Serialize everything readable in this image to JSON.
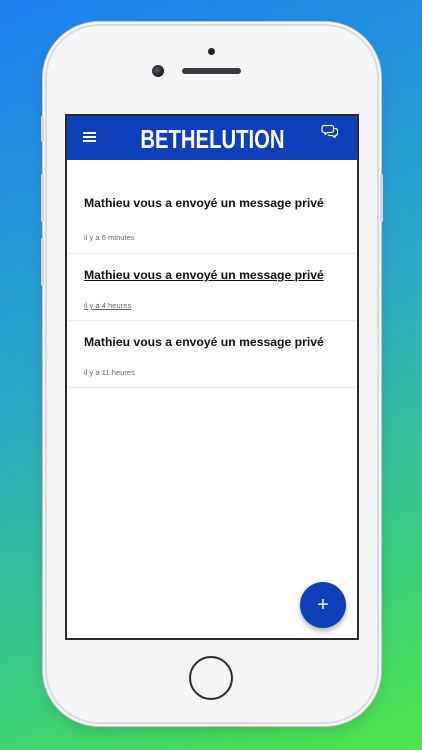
{
  "app": {
    "title": "BETHELUTION",
    "brand_color": "#0d3fb8"
  },
  "icons": {
    "menu": "hamburger-menu-icon",
    "chat": "chat-bubbles-icon",
    "add": "plus-icon"
  },
  "notifications": [
    {
      "title": "Mathieu vous a envoyé un message privé",
      "time": "il y a 6 minutes"
    },
    {
      "title": "Mathieu vous a envoyé un message privé",
      "time": "il y a 4 heures"
    },
    {
      "title": "Mathieu vous a envoyé un message privé",
      "time": "il y a 11 heures"
    }
  ],
  "fab": {
    "label": "+"
  }
}
